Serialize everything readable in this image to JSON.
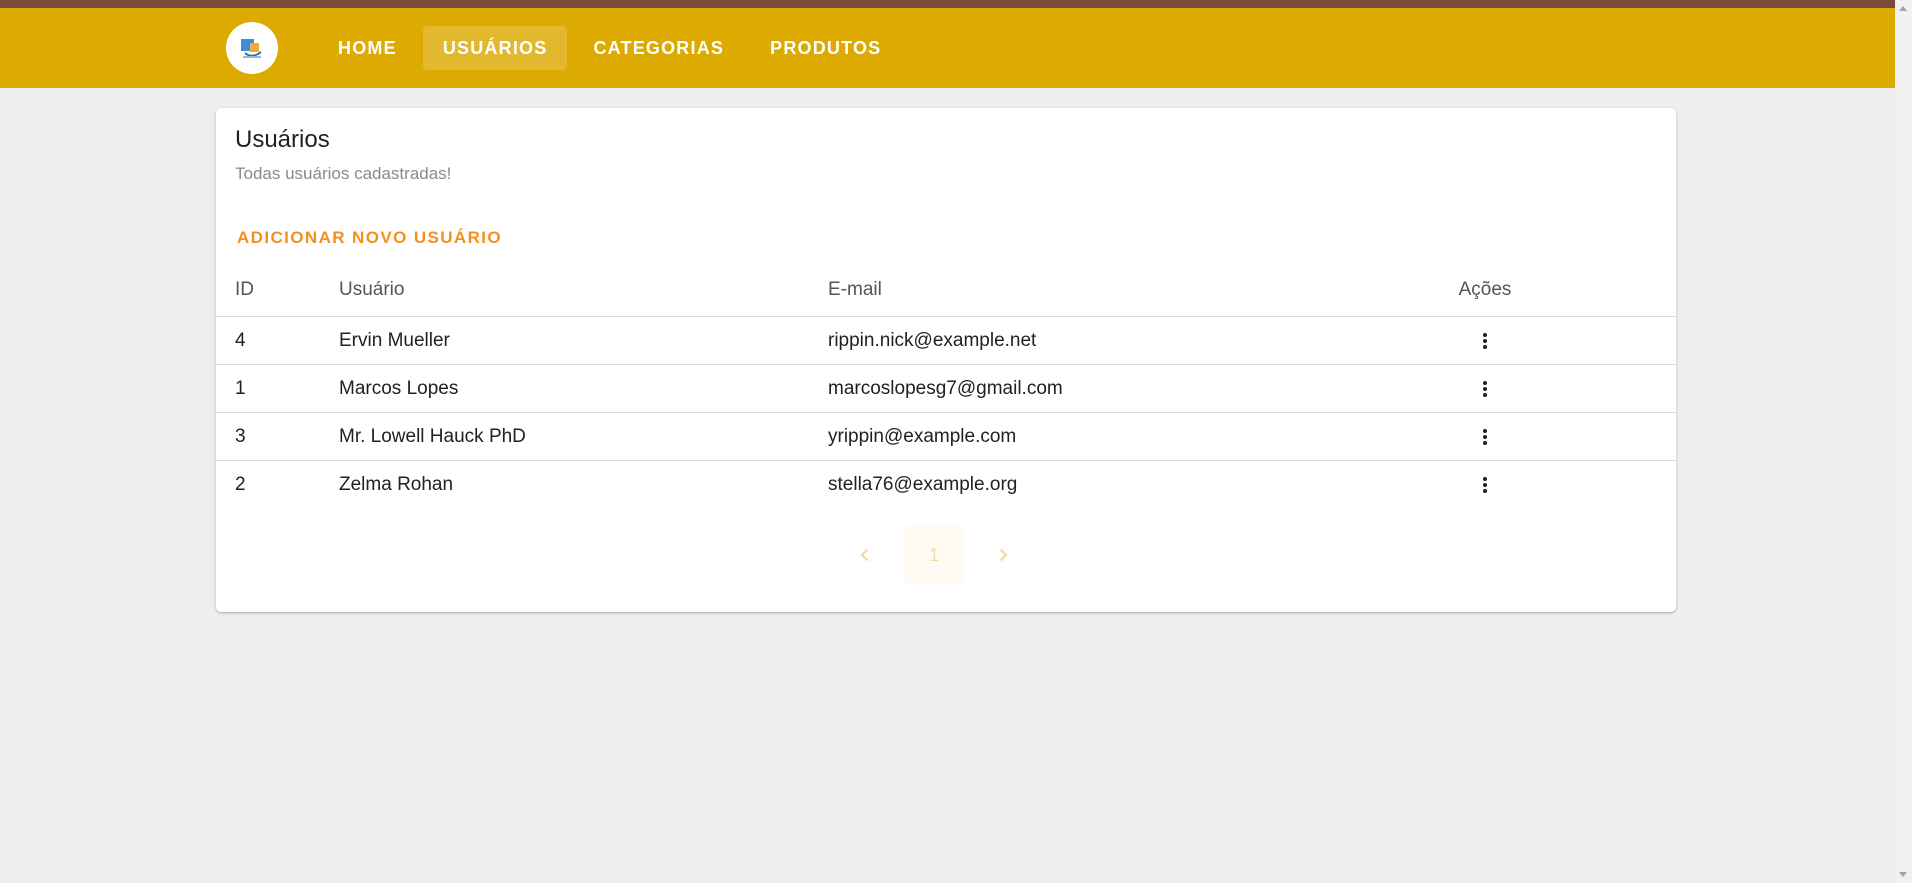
{
  "nav": {
    "items": [
      {
        "label": "HOME",
        "active": false
      },
      {
        "label": "USUÁRIOS",
        "active": true
      },
      {
        "label": "CATEGORIAS",
        "active": false
      },
      {
        "label": "PRODUTOS",
        "active": false
      }
    ]
  },
  "card": {
    "title": "Usuários",
    "subtitle": "Todas usuários cadastradas!",
    "add_button": "ADICIONAR NOVO USUÁRIO"
  },
  "table": {
    "headers": {
      "id": "ID",
      "user": "Usuário",
      "email": "E-mail",
      "actions": "Ações"
    },
    "rows": [
      {
        "id": "4",
        "user": "Ervin Mueller",
        "email": "rippin.nick@example.net"
      },
      {
        "id": "1",
        "user": "Marcos Lopes",
        "email": "marcoslopesg7@gmail.com"
      },
      {
        "id": "3",
        "user": "Mr. Lowell Hauck PhD",
        "email": "yrippin@example.com"
      },
      {
        "id": "2",
        "user": "Zelma Rohan",
        "email": "stella76@example.org"
      }
    ]
  },
  "pagination": {
    "current_page": "1"
  },
  "colors": {
    "appbar": "#dcaa00",
    "top_strip": "#7a4a3a",
    "accent": "#f5901e",
    "background": "#eeeeee"
  },
  "icons": {
    "row_actions": "dots-vertical-icon",
    "prev": "chevron-left-icon",
    "next": "chevron-right-icon",
    "logo": "logo-icon"
  }
}
